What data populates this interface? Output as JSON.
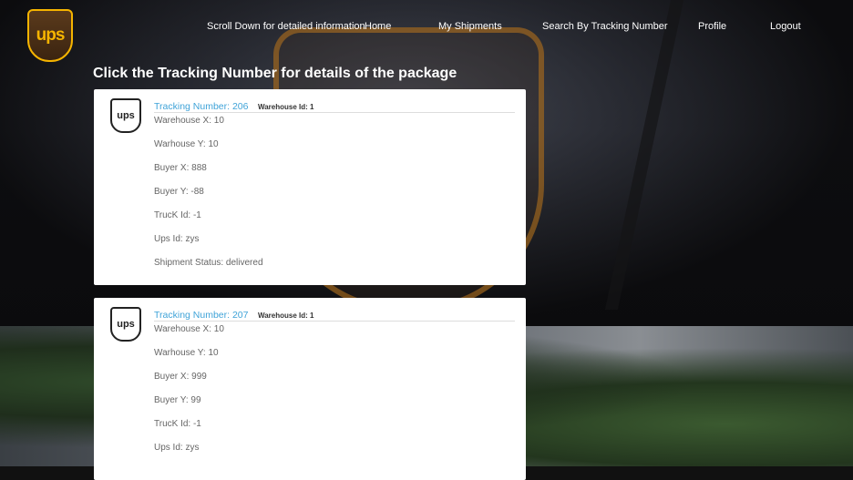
{
  "nav": {
    "brand": "ups",
    "links": [
      "Scroll Down for detailed information",
      "Home",
      "My Shipments",
      "Search By Tracking Number",
      "Profile",
      "Logout"
    ]
  },
  "page_title": "Click the Tracking Number for details of the package",
  "cards": [
    {
      "tracking": "Tracking Number: 206",
      "warehouse": "Warehouse Id: 1",
      "fields": [
        "Warehouse X: 10",
        "Warhouse Y: 10",
        "Buyer X: 888",
        "Buyer Y: -88",
        "TrucK Id: -1",
        "Ups Id: zys",
        "Shipment Status: delivered"
      ]
    },
    {
      "tracking": "Tracking Number: 207",
      "warehouse": "Warehouse Id: 1",
      "fields": [
        "Warehouse X: 10",
        "Warhouse Y: 10",
        "Buyer X: 999",
        "Buyer Y: 99",
        "TrucK Id: -1",
        "Ups Id: zys"
      ]
    }
  ]
}
